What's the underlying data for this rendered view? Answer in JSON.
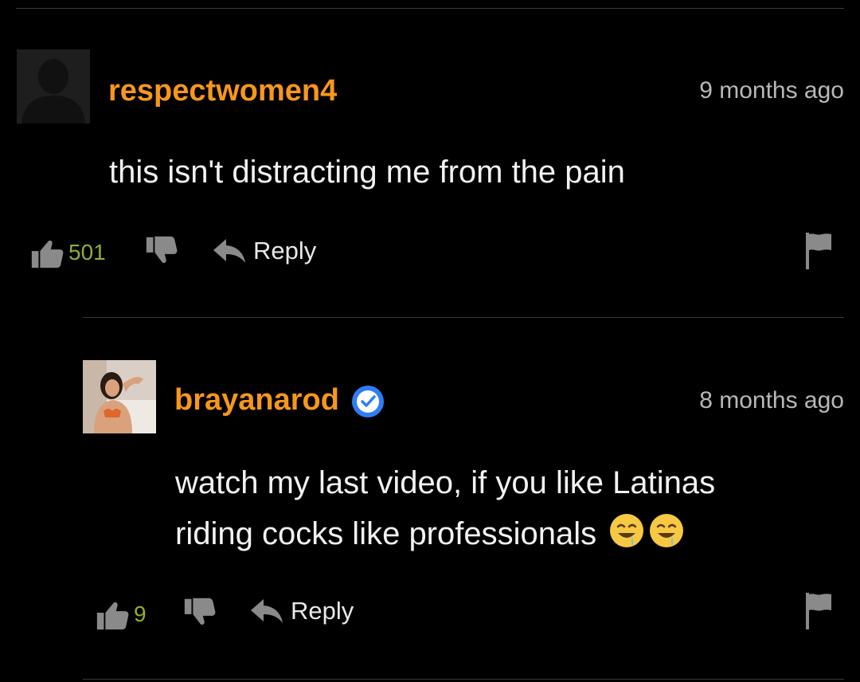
{
  "comments": [
    {
      "username": "respectwomen4",
      "timestamp": "9 months ago",
      "text": "this isn't distracting me from the pain",
      "likes": "501",
      "reply_label": "Reply",
      "avatar": "default-avatar-silhouette"
    },
    {
      "username": "brayanarod",
      "verified": true,
      "timestamp": "8 months ago",
      "text_line1": "watch my last video, if you like Latinas",
      "text_line2": "riding cocks like professionals",
      "emojis": [
        "drooling-face-emoji",
        "drooling-face-emoji"
      ],
      "likes": "9",
      "reply_label": "Reply",
      "avatar": "user-photo"
    }
  ],
  "colors": {
    "background": "#000000",
    "username": "#f7971d",
    "timestamp": "#b8b8b8",
    "like_count": "#8fae3a",
    "icon_gray": "#8a8a8a",
    "verified_blue": "#2f7df6",
    "divider": "#3a3a3a"
  }
}
